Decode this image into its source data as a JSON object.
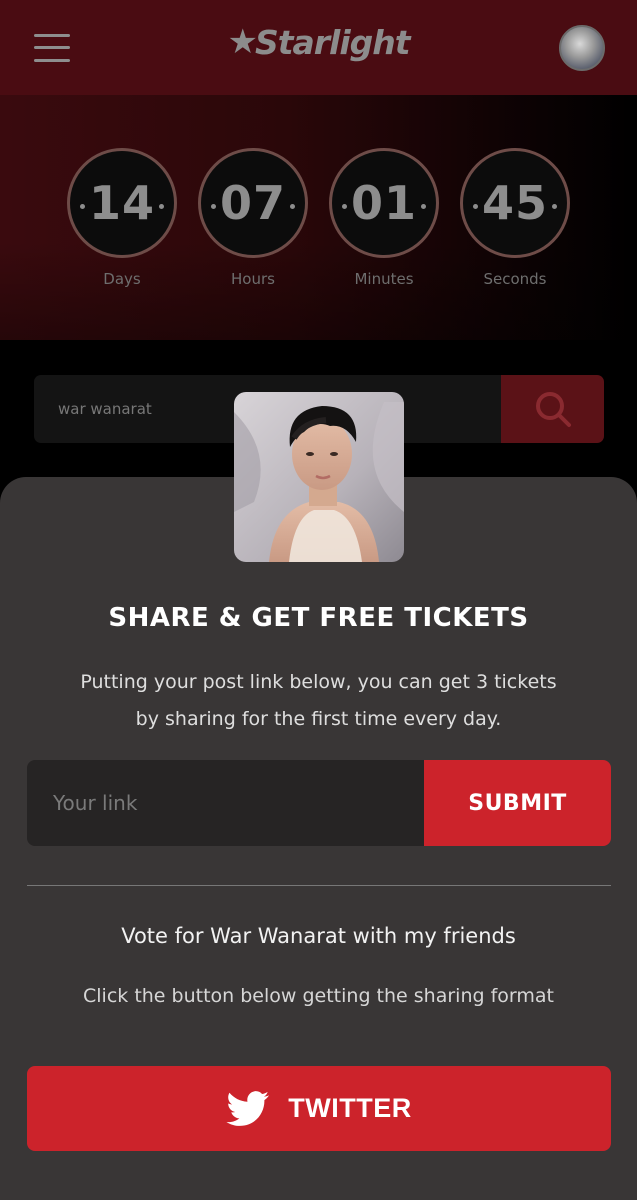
{
  "header": {
    "logo_star": "★",
    "logo_text": "Starlight",
    "menu_icon": "hamburger-menu-icon",
    "avatar_icon": "user-avatar"
  },
  "countdown": [
    {
      "value": "14",
      "label": "Days"
    },
    {
      "value": "07",
      "label": "Hours"
    },
    {
      "value": "01",
      "label": "Minutes"
    },
    {
      "value": "45",
      "label": "Seconds"
    }
  ],
  "search": {
    "value": "war wanarat",
    "icon": "search-icon"
  },
  "modal": {
    "title": "SHARE & GET FREE TICKETS",
    "description_line1": "Putting your post link below, you can get 3 tickets",
    "description_line2": "by sharing for the first time every day.",
    "link_placeholder": "Your link",
    "submit_label": "SUBMIT",
    "vote_text": "Vote for War Wanarat with my friends",
    "click_text": "Click the button below getting the sharing format",
    "twitter_label": "TWITTER",
    "twitter_icon": "twitter-bird-icon"
  },
  "colors": {
    "header_bg": "#4a0c12",
    "accent_red": "#cc232b",
    "modal_bg": "#393636",
    "search_btn_bg": "#5b1217"
  }
}
